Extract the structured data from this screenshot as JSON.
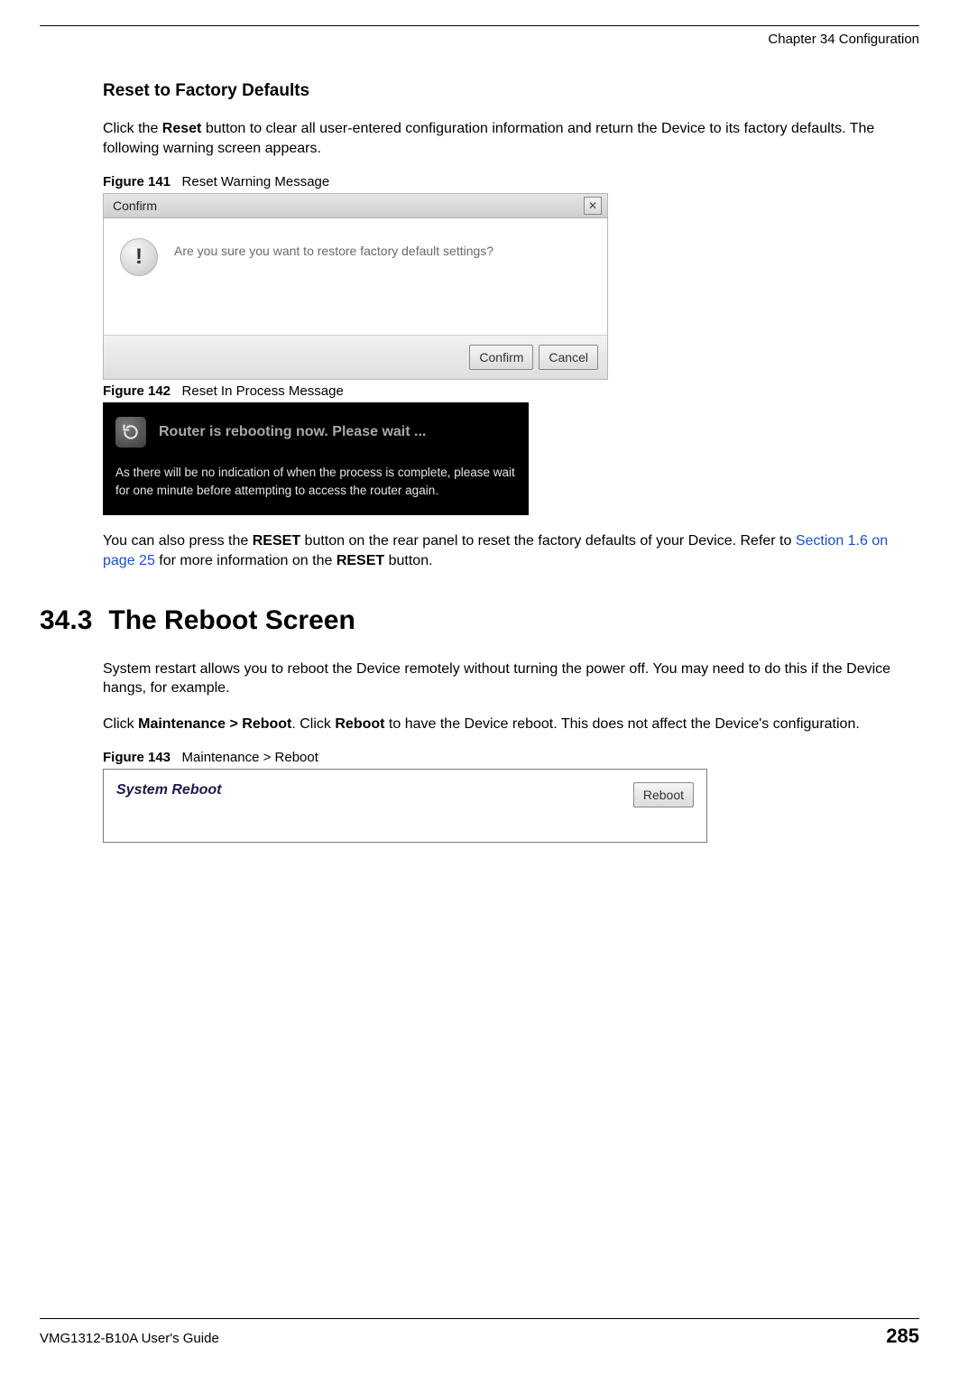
{
  "header": {
    "chapter_line": "Chapter 34 Configuration"
  },
  "section_reset": {
    "heading": "Reset to Factory Defaults",
    "intro_pre": "Click the ",
    "intro_bold1": "Reset",
    "intro_post": " button to clear all user-entered configuration information and return the Device to its factory defaults. The following warning screen appears."
  },
  "fig141": {
    "label": "Figure 141",
    "caption": "Reset Warning Message",
    "title": "Confirm",
    "message": "Are you sure you want to restore factory default settings?",
    "confirm_btn": "Confirm",
    "cancel_btn": "Cancel"
  },
  "fig142": {
    "label": "Figure 142",
    "caption": "Reset In Process Message",
    "line1": "Router is rebooting now. Please wait ...",
    "line2": "As there will be no indication of when the process is complete, please wait for one minute before attempting to access the router again."
  },
  "post142": {
    "p1_pre": "You can also press the ",
    "p1_bold1": "RESET",
    "p1_mid": " button on the rear panel to reset the factory defaults of your Device. Refer to ",
    "p1_link": "Section 1.6 on page 25",
    "p1_mid2": " for more information on the ",
    "p1_bold2": "RESET",
    "p1_post": " button."
  },
  "sec343": {
    "num": "34.3",
    "title": "The Reboot Screen",
    "p1": "System restart allows you to reboot the Device remotely without turning the power off. You may need to do this if the Device hangs, for example.",
    "p2_pre": "Click ",
    "p2_bold1": "Maintenance > Reboot",
    "p2_mid": ". Click ",
    "p2_bold2": "Reboot",
    "p2_post": " to have the Device reboot. This does not affect the Device's configuration."
  },
  "fig143": {
    "label": "Figure 143",
    "caption": "Maintenance > Reboot",
    "panel_title": "System Reboot",
    "reboot_btn": "Reboot"
  },
  "footer": {
    "guide": "VMG1312-B10A User's Guide",
    "page": "285"
  }
}
